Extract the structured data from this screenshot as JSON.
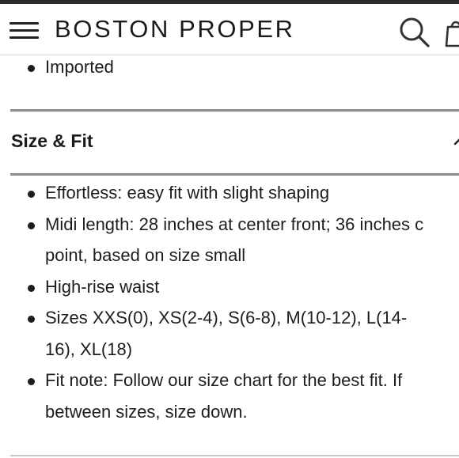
{
  "header": {
    "brand": "BOSTON PROPER",
    "menu_icon": "hamburger-menu-icon",
    "search_icon": "search-icon",
    "bag_icon": "shopping-bag-icon"
  },
  "details": {
    "items": [
      "Imported"
    ]
  },
  "size_fit": {
    "title": "Size & Fit",
    "expanded": true,
    "items": [
      {
        "lines": [
          "Effortless: easy fit with slight shaping"
        ]
      },
      {
        "lines": [
          "Midi length: 28 inches at center front; 36 inches c",
          "point, based on size small"
        ]
      },
      {
        "lines": [
          "High-rise waist"
        ]
      },
      {
        "lines": [
          "Sizes XXS(0), XS(2-4), S(6-8), M(10-12), L(14-",
          "16), XL(18)"
        ]
      },
      {
        "lines": [
          "Fit note: Follow our size chart for the best fit. If",
          "between sizes, size down."
        ]
      }
    ]
  },
  "colors": {
    "top_bar": "#2b2b2b",
    "text": "#1a1a1a",
    "divider": "#8c8c8c"
  }
}
